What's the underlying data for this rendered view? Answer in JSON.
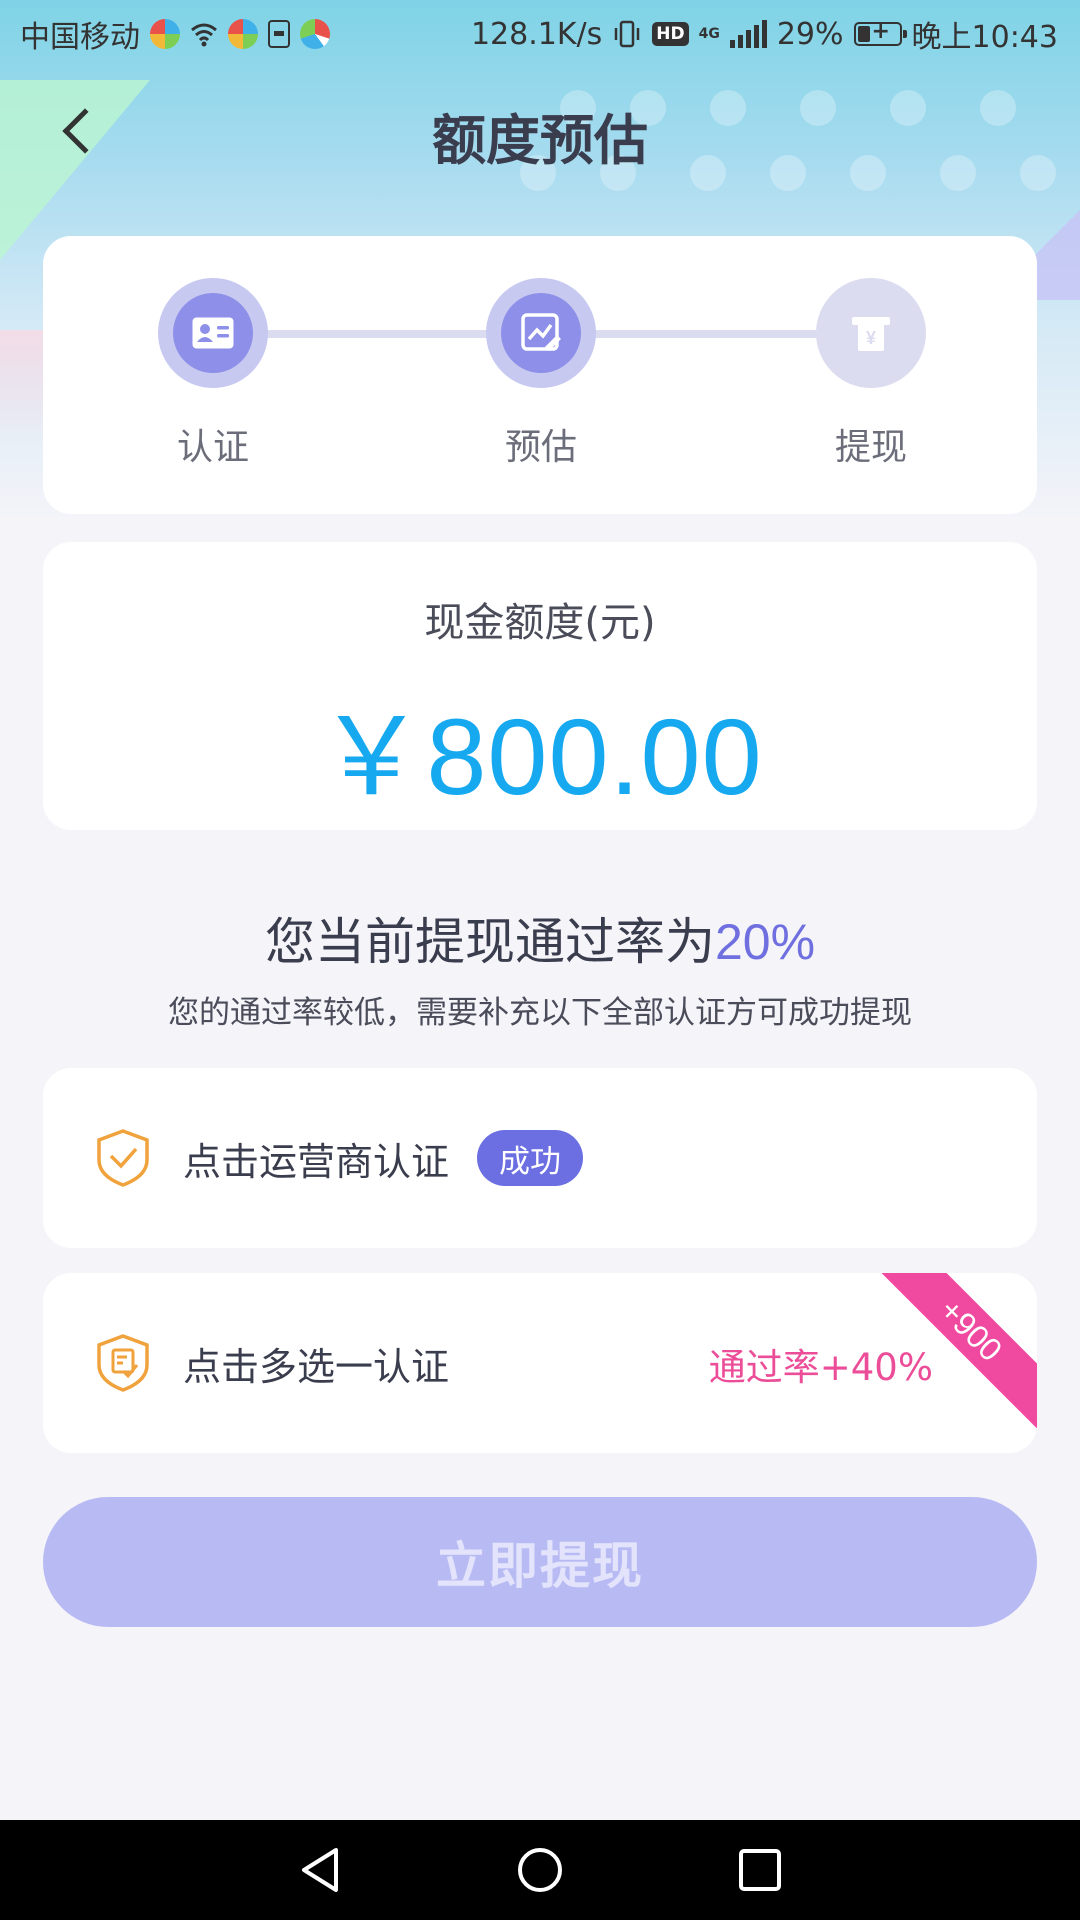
{
  "status_bar": {
    "carrier": "中国移动",
    "speed": "128.1K/s",
    "network_badge": "HD",
    "network_type": "4G",
    "battery": "29%",
    "time": "晚上10:43"
  },
  "header": {
    "title": "额度预估"
  },
  "steps": [
    {
      "label": "认证",
      "icon": "id-card-icon",
      "state": "active"
    },
    {
      "label": "预估",
      "icon": "chart-edit-icon",
      "state": "active"
    },
    {
      "label": "提现",
      "icon": "yen-withdraw-icon",
      "state": "inactive"
    }
  ],
  "amount": {
    "label": "现金额度(元)",
    "value": "￥800.00"
  },
  "pass_rate": {
    "prefix": "您当前提现通过率为",
    "value": "20%",
    "description": "您的通过率较低，需要补充以下全部认证方可成功提现"
  },
  "verifications": [
    {
      "label": "点击运营商认证",
      "badge": "成功"
    },
    {
      "label": "点击多选一认证",
      "bonus": "通过率+40%",
      "ribbon": "+900"
    }
  ],
  "action": {
    "withdraw_label": "立即提现"
  },
  "colors": {
    "accent": "#6b6fe2",
    "amount": "#17a9f0",
    "bonus": "#ec4d98",
    "shield": "#f0a23c"
  }
}
